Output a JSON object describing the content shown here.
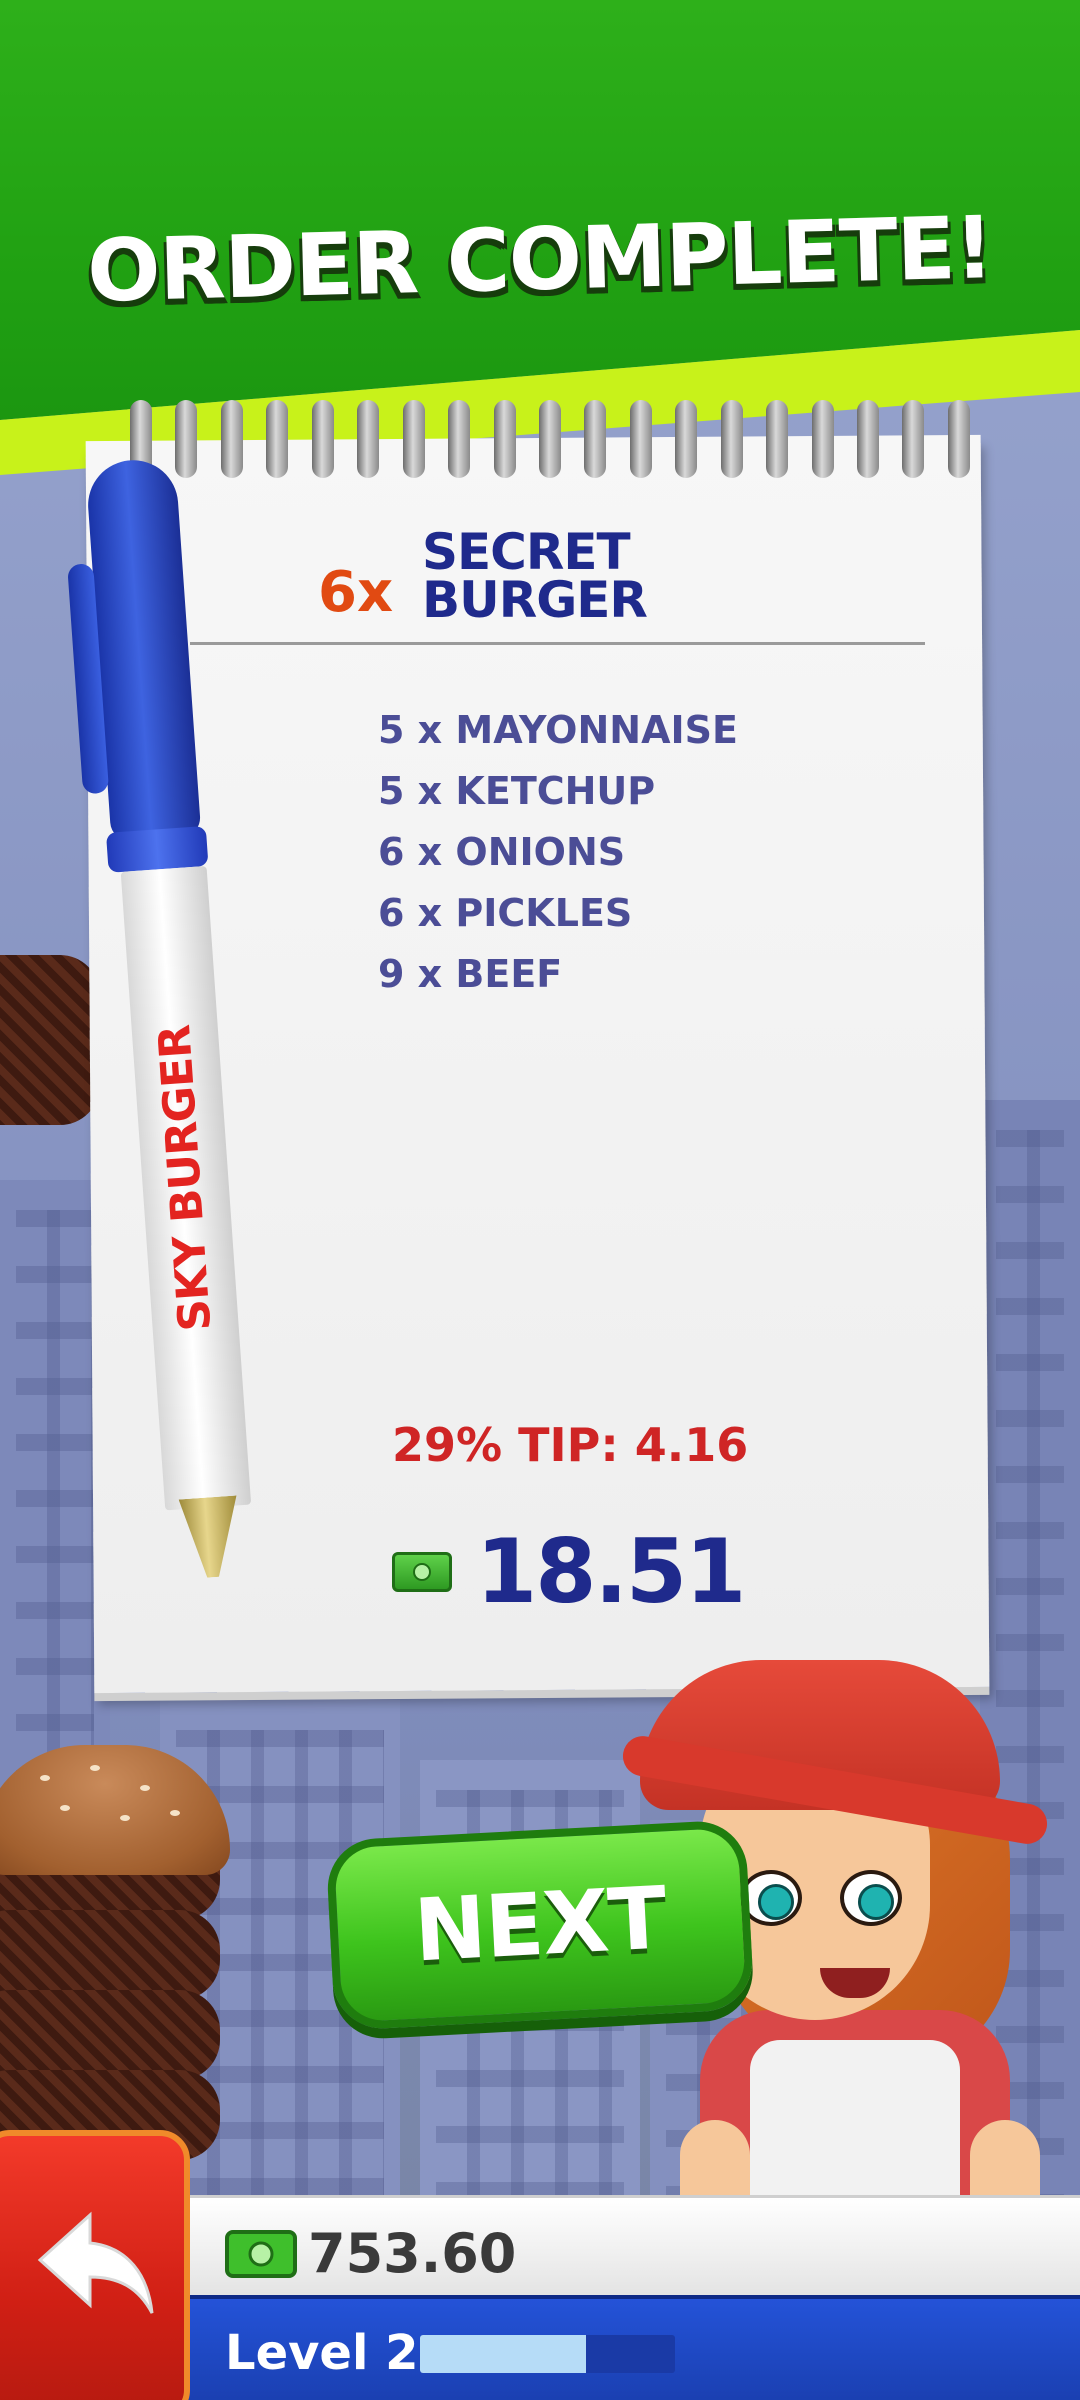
{
  "header": {
    "title": "ORDER COMPLETE!"
  },
  "pen": {
    "brand": "SKY BURGER"
  },
  "order": {
    "quantity": "6x",
    "name_line1": "SECRET",
    "name_line2": "BURGER",
    "ingredients": [
      "5 x MAYONNAISE",
      "5 x KETCHUP",
      "6 x ONIONS",
      "6 x PICKLES",
      "9 x BEEF"
    ],
    "tip": "29% TIP: 4.16",
    "total": "18.51"
  },
  "buttons": {
    "next": "NEXT"
  },
  "hud": {
    "money": "753.60",
    "level": "Level 2",
    "xp_progress": 0.65
  },
  "icons": {
    "money": "cash-icon",
    "back": "back-arrow-icon"
  },
  "colors": {
    "banner_green": "#2eb01a",
    "stripe_lime": "#c8f21a",
    "title_blue": "#1f2a8c",
    "tip_red": "#cf2525",
    "qty_orange": "#e14a12",
    "next_green": "#3ec41d",
    "hud_blue": "#2453d8"
  }
}
